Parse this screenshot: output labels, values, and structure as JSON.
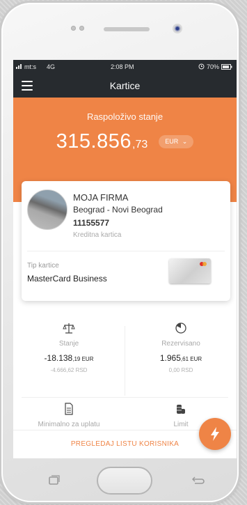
{
  "statusbar": {
    "carrier": "mt:s",
    "network": "4G",
    "time": "2:08 PM",
    "battery": "70%"
  },
  "header": {
    "title": "Kartice"
  },
  "balance": {
    "label": "Raspoloživo stanje",
    "integer": "315.856",
    "decimals": ",73",
    "currency": "EUR"
  },
  "card": {
    "name": "MOJA FIRMA",
    "address": "Beograd - Novi Beograd",
    "number": "11155577",
    "type_label": "Kreditna kartica",
    "card_type_label": "Tip kartice",
    "card_type_value": "MasterCard Business"
  },
  "stats": {
    "stanje": {
      "label": "Stanje",
      "value_int": "-18.138",
      "value_dec": ",19 EUR",
      "sub_int": "-4.666",
      "sub_dec": ",62 RSD"
    },
    "rezervisano": {
      "label": "Rezervisano",
      "value_int": "1.965",
      "value_dec": ",61 EUR",
      "sub_int": "0",
      "sub_dec": ",00 RSD"
    },
    "minimalno": {
      "label": "Minimalno za uplatu"
    },
    "limit": {
      "label": "Limit"
    }
  },
  "bottom": {
    "link_label": "PREGLEDAJ LISTU KORISNIKA"
  },
  "colors": {
    "accent": "#ef8446",
    "dark": "#272b2f"
  },
  "icons": [
    "hamburger-icon",
    "scale-icon",
    "clock-icon",
    "document-icon",
    "coins-icon",
    "flash-icon",
    "signal-icon",
    "battery-icon",
    "alarm-icon"
  ]
}
